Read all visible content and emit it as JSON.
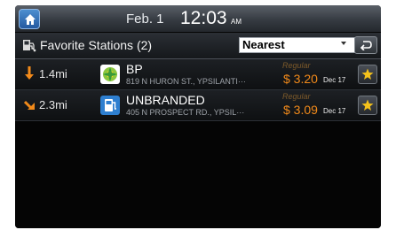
{
  "header": {
    "date": "Feb.  1",
    "time": "12:03",
    "ampm": "AM"
  },
  "subheader": {
    "title": "Favorite Stations (2)",
    "sort": {
      "selected": "Nearest"
    }
  },
  "stations": [
    {
      "distance": "1.4mi",
      "name": "BP",
      "address": "819 N HURON ST., YPSILANTI···",
      "fuel_type": "Regular",
      "price": "$ 3.20",
      "price_date": "Dec 17",
      "direction_icon": "arrow-down-icon",
      "logo_icon": "bp-logo-icon"
    },
    {
      "distance": "2.3mi",
      "name": "UNBRANDED",
      "address": "405 N PROSPECT RD., YPSIL···",
      "fuel_type": "Regular",
      "price": "$ 3.09",
      "price_date": "Dec 17",
      "direction_icon": "arrow-down-right-icon",
      "logo_icon": "fuel-pump-icon"
    }
  ],
  "colors": {
    "accent_orange": "#f28a1a",
    "star_yellow": "#f5c21b",
    "home_blue": "#2f6db8"
  }
}
